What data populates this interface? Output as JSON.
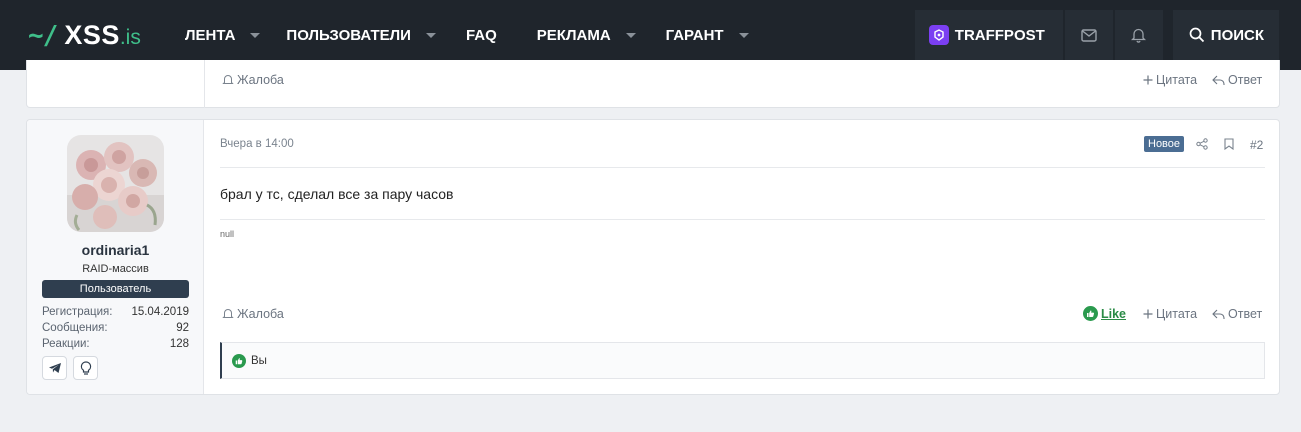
{
  "navbar": {
    "logo": {
      "prefix": "~/",
      "name": "XSS",
      "tld": ".is"
    },
    "items": [
      {
        "label": "ЛЕНТА",
        "has_menu": true
      },
      {
        "label": "ПОЛЬЗОВАТЕЛИ",
        "has_menu": true
      },
      {
        "label": "FAQ",
        "has_menu": false
      },
      {
        "label": "РЕКЛАМА",
        "has_menu": true
      },
      {
        "label": "ГАРАНТ",
        "has_menu": true
      }
    ],
    "traff_label": "TRAFFPOST",
    "mail_icon": "envelope-icon",
    "alerts_icon": "bell-icon",
    "search_label": "ПОИСК"
  },
  "prev_post": {
    "report_label": "Жалоба",
    "quote_label": "Цитата",
    "reply_label": "Ответ"
  },
  "post": {
    "author": {
      "username": "ordinaria1",
      "title": "RAID-массив",
      "banner": "Пользователь",
      "stats": [
        {
          "key": "Регистрация:",
          "value": "15.04.2019"
        },
        {
          "key": "Сообщения:",
          "value": "92"
        },
        {
          "key": "Реакции:",
          "value": "128"
        }
      ],
      "contacts": [
        "telegram-icon",
        "lightbulb-icon"
      ]
    },
    "date": "Вчера в 14:00",
    "new_badge": "Новое",
    "number": "#2",
    "message": "брал у тс, сделал все за пару часов",
    "signature": "null",
    "report_label": "Жалоба",
    "like_label": "Like",
    "quote_label": "Цитата",
    "reply_label": "Ответ",
    "reactions_text": "Вы"
  },
  "colors": {
    "nav_bg": "#1f252c",
    "accent_green": "#3fbf8a",
    "like_green": "#2a8b46",
    "badge_blue": "#4b6d93",
    "banner_dark": "#2f3e4f",
    "traff_purple": "#7b3ff2"
  }
}
